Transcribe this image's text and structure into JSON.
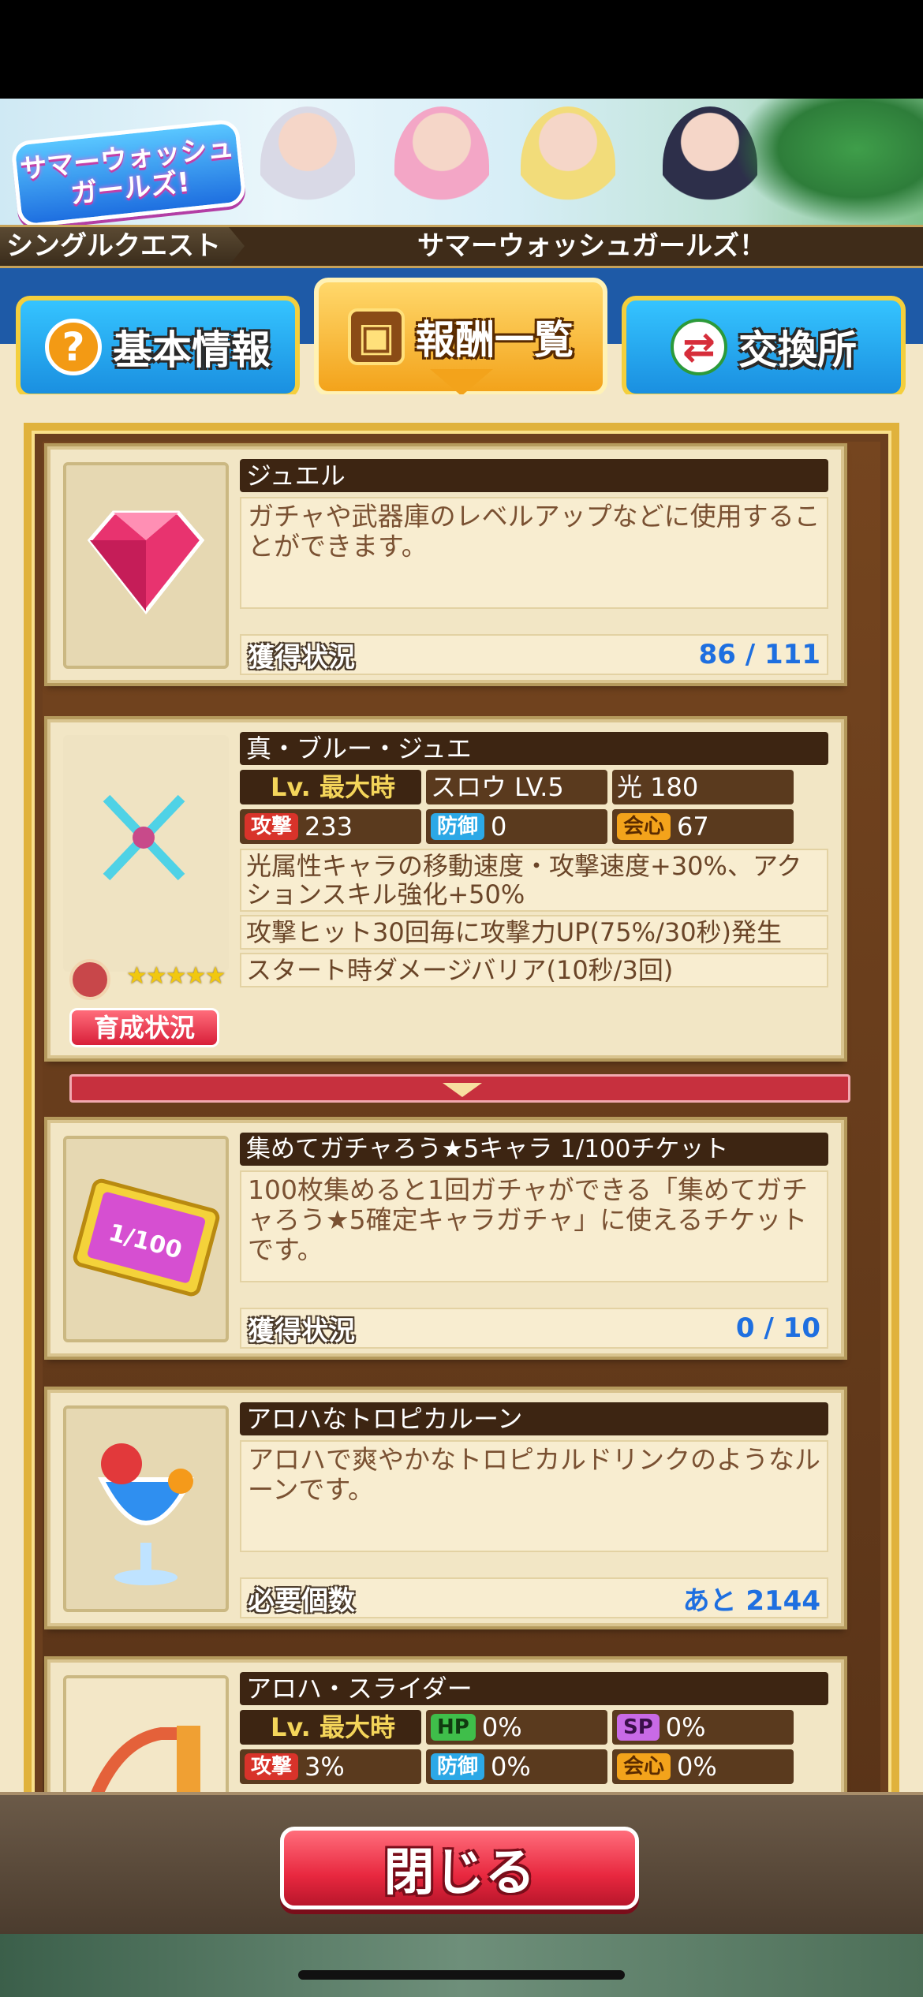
{
  "banner": {
    "logo_text": "サマーウォッシュガールズ!"
  },
  "quest": {
    "tag": "シングルクエスト",
    "title": "サマーウォッシュガールズ！"
  },
  "tabs": [
    {
      "label": "基本情報",
      "icon": "question-icon"
    },
    {
      "label": "報酬一覧",
      "icon": "treasure-chest-icon",
      "active": true
    },
    {
      "label": "交換所",
      "icon": "exchange-icon"
    }
  ],
  "rewards": {
    "jewel": {
      "name": "ジュエル",
      "desc": "ガチャや武器庫のレベルアップなどに使用することができます。",
      "status_label": "獲得状況",
      "status_value": "86 / 111"
    },
    "weapon": {
      "name": "真・ブルー・ジュエ",
      "level": "Lv. 最大時",
      "speed": "スロウ LV.5",
      "element": "光 180",
      "atk_label": "攻撃",
      "atk": "233",
      "def_label": "防御",
      "def": "0",
      "crit_label": "会心",
      "crit": "67",
      "skill1": "光属性キャラの移動速度・攻撃速度+30%、アクションスキル強化+50%",
      "skill2": "攻撃ヒット30回毎に攻撃力UP(75%/30秒)発生",
      "skill3": "スタート時ダメージバリア(10秒/3回)",
      "train_button": "育成状況",
      "stars": "★★★★★"
    },
    "ticket": {
      "name": "集めてガチャろう★5キャラ 1/100チケット",
      "desc": "100枚集めると1回ガチャができる「集めてガチャろう★5確定キャラガチャ」に使えるチケットです。",
      "status_label": "獲得状況",
      "status_value": "0 / 10"
    },
    "rune": {
      "name": "アロハなトロピカルーン",
      "desc": "アロハで爽やかなトロピカルドリンクのようなルーンです。",
      "status_label": "必要個数",
      "status_value": "あと 2144"
    },
    "slider": {
      "name": "アロハ・スライダー",
      "level": "Lv. 最大時",
      "hp_label": "HP",
      "hp": "0%",
      "sp_label": "SP",
      "sp": "0%",
      "atk_label": "攻撃",
      "atk": "3%",
      "def_label": "防御",
      "def": "0%",
      "crit_label": "会心",
      "crit": "0%"
    }
  },
  "close_button": "閉じる",
  "colors": {
    "accent_blue": "#1e6fe0",
    "close_red": "#e8283f",
    "name_bar": "#3d2512"
  }
}
